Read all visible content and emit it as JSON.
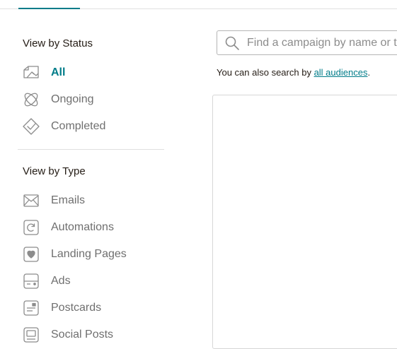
{
  "status_section": {
    "heading": "View by Status",
    "items": [
      {
        "label": "All",
        "icon": "all-campaigns-icon",
        "active": true
      },
      {
        "label": "Ongoing",
        "icon": "ongoing-icon",
        "active": false
      },
      {
        "label": "Completed",
        "icon": "completed-icon",
        "active": false
      }
    ]
  },
  "type_section": {
    "heading": "View by Type",
    "items": [
      {
        "label": "Emails",
        "icon": "email-icon"
      },
      {
        "label": "Automations",
        "icon": "automation-icon"
      },
      {
        "label": "Landing Pages",
        "icon": "landing-page-icon"
      },
      {
        "label": "Ads",
        "icon": "ads-icon"
      },
      {
        "label": "Postcards",
        "icon": "postcard-icon"
      },
      {
        "label": "Social Posts",
        "icon": "social-post-icon"
      }
    ]
  },
  "search": {
    "placeholder": "Find a campaign by name or type",
    "hint_prefix": "You can also search by ",
    "hint_link": "all audiences",
    "hint_suffix": "."
  },
  "colors": {
    "accent": "#007c89",
    "text": "#241c15",
    "muted": "#6f6f6f",
    "icon": "#8c8c8c",
    "border": "#d6d6d6"
  }
}
